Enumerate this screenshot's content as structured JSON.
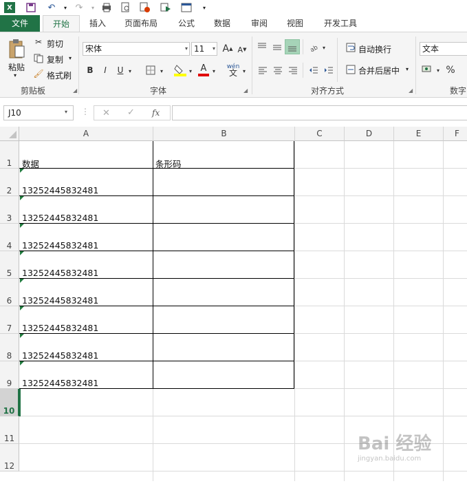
{
  "qat": {
    "icons": [
      "excel-logo-icon",
      "save-icon",
      "undo-icon",
      "redo-icon",
      "print-preview-icon",
      "find-icon",
      "clear-icon",
      "macro-icon",
      "form-icon",
      "customize-icon"
    ]
  },
  "tabs": [
    {
      "label": "文件"
    },
    {
      "label": "开始"
    },
    {
      "label": "插入"
    },
    {
      "label": "页面布局"
    },
    {
      "label": "公式"
    },
    {
      "label": "数据"
    },
    {
      "label": "审阅"
    },
    {
      "label": "视图"
    },
    {
      "label": "开发工具"
    }
  ],
  "ribbon": {
    "clipboard": {
      "paste": "粘贴",
      "cut": "剪切",
      "copy": "复制",
      "format_painter": "格式刷",
      "label": "剪贴板"
    },
    "font": {
      "name": "宋体",
      "size": "11",
      "bold": "B",
      "italic": "I",
      "underline": "U",
      "grow": "A",
      "shrink": "A",
      "color_letter": "A",
      "phonetic": "wén",
      "label": "字体",
      "highlight_color": "#ffff00",
      "font_color": "#e00000"
    },
    "alignment": {
      "wrap": "自动换行",
      "merge": "合并后居中",
      "label": "对齐方式"
    },
    "number": {
      "format": "文本",
      "percent": "%",
      "label": "数字"
    }
  },
  "formula_bar": {
    "name_box": "J10",
    "fx": "fx",
    "value": ""
  },
  "grid": {
    "columns": [
      "A",
      "B",
      "C",
      "D",
      "E",
      "F"
    ],
    "rows": [
      "1",
      "2",
      "3",
      "4",
      "5",
      "6",
      "7",
      "8",
      "9",
      "10",
      "11",
      "12"
    ],
    "selected_row": "10",
    "cells": {
      "A1": "数据",
      "B1": "条形码",
      "A2": "13252445832481",
      "A3": "13252445832481",
      "A4": "13252445832481",
      "A5": "13252445832481",
      "A6": "13252445832481",
      "A7": "13252445832481",
      "A8": "13252445832481",
      "A9": "13252445832481"
    },
    "error_indicator_color": "#1e7a3c"
  },
  "watermark": {
    "text": "Bai 经验",
    "subtext": "jingyan.baidu.com"
  }
}
